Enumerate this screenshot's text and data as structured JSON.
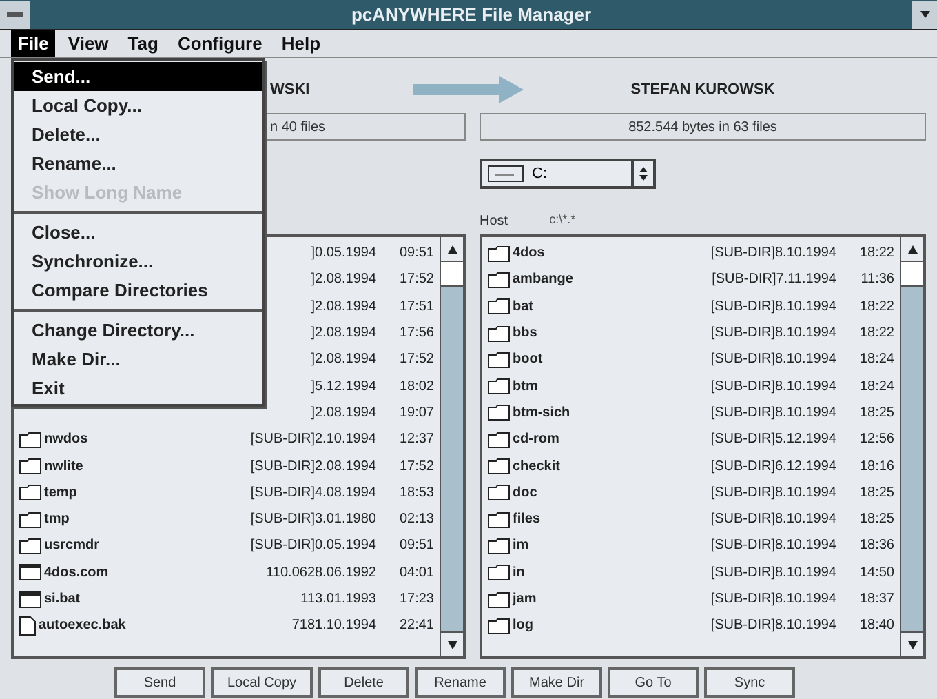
{
  "window": {
    "title": "pcANYWHERE File Manager"
  },
  "menu_bar": [
    {
      "label": "File",
      "selected": true
    },
    {
      "label": "View",
      "selected": false
    },
    {
      "label": "Tag",
      "selected": false
    },
    {
      "label": "Configure",
      "selected": false
    },
    {
      "label": "Help",
      "selected": false
    }
  ],
  "file_menu": [
    {
      "kind": "item",
      "label": "Send...",
      "selected": true,
      "disabled": false
    },
    {
      "kind": "item",
      "label": "Local Copy...",
      "selected": false,
      "disabled": false
    },
    {
      "kind": "item",
      "label": "Delete...",
      "selected": false,
      "disabled": false
    },
    {
      "kind": "item",
      "label": "Rename...",
      "selected": false,
      "disabled": false
    },
    {
      "kind": "item",
      "label": "Show Long Name",
      "selected": false,
      "disabled": true
    },
    {
      "kind": "separator"
    },
    {
      "kind": "item",
      "label": "Close...",
      "selected": false,
      "disabled": false
    },
    {
      "kind": "item",
      "label": "Synchronize...",
      "selected": false,
      "disabled": false
    },
    {
      "kind": "item",
      "label": "Compare Directories",
      "selected": false,
      "disabled": false
    },
    {
      "kind": "separator"
    },
    {
      "kind": "item",
      "label": "Change Directory...",
      "selected": false,
      "disabled": false
    },
    {
      "kind": "item",
      "label": "Make Dir...",
      "selected": false,
      "disabled": false
    },
    {
      "kind": "item",
      "label": "Exit",
      "selected": false,
      "disabled": false
    }
  ],
  "left_panel": {
    "computer": "WSKI",
    "summary": "n 40 files",
    "files": [
      {
        "info": "]0.05.1994",
        "time": "09:51"
      },
      {
        "info": "]2.08.1994",
        "time": "17:52"
      },
      {
        "info": "]2.08.1994",
        "time": "17:51"
      },
      {
        "info": "]2.08.1994",
        "time": "17:56"
      },
      {
        "info": "]2.08.1994",
        "time": "17:52"
      },
      {
        "info": "]5.12.1994",
        "time": "18:02"
      },
      {
        "info": "]2.08.1994",
        "time": "19:07"
      },
      {
        "kind": "folder",
        "name": "nwdos",
        "info": "[SUB-DIR]2.10.1994",
        "time": "12:37"
      },
      {
        "kind": "folder",
        "name": "nwlite",
        "info": "[SUB-DIR]2.08.1994",
        "time": "17:52"
      },
      {
        "kind": "folder",
        "name": "temp",
        "info": "[SUB-DIR]4.08.1994",
        "time": "18:53"
      },
      {
        "kind": "folder",
        "name": "tmp",
        "info": "[SUB-DIR]3.01.1980",
        "time": "02:13"
      },
      {
        "kind": "folder",
        "name": "usrcmdr",
        "info": "[SUB-DIR]0.05.1994",
        "time": "09:51"
      },
      {
        "kind": "program",
        "name": "4dos.com",
        "info": "110.0628.06.1992",
        "time": "04:01"
      },
      {
        "kind": "program",
        "name": "si.bat",
        "info": "113.01.1993",
        "time": "17:23"
      },
      {
        "kind": "document",
        "name": "autoexec.bak",
        "info": "7181.10.1994",
        "time": "22:41"
      }
    ]
  },
  "right_panel": {
    "computer": "STEFAN KUROWSK",
    "summary": "852.544 bytes in 63 files",
    "drive": "C:",
    "path_label": "Host",
    "path": "c:\\*.*",
    "files": [
      {
        "kind": "folder",
        "name": "4dos",
        "info": "[SUB-DIR]8.10.1994",
        "time": "18:22"
      },
      {
        "kind": "folder",
        "name": "ambange",
        "info": "[SUB-DIR]7.11.1994",
        "time": "11:36"
      },
      {
        "kind": "folder",
        "name": "bat",
        "info": "[SUB-DIR]8.10.1994",
        "time": "18:22"
      },
      {
        "kind": "folder",
        "name": "bbs",
        "info": "[SUB-DIR]8.10.1994",
        "time": "18:22"
      },
      {
        "kind": "folder",
        "name": "boot",
        "info": "[SUB-DIR]8.10.1994",
        "time": "18:24"
      },
      {
        "kind": "folder",
        "name": "btm",
        "info": "[SUB-DIR]8.10.1994",
        "time": "18:24"
      },
      {
        "kind": "folder",
        "name": "btm-sich",
        "info": "[SUB-DIR]8.10.1994",
        "time": "18:25"
      },
      {
        "kind": "folder",
        "name": "cd-rom",
        "info": "[SUB-DIR]5.12.1994",
        "time": "12:56"
      },
      {
        "kind": "folder",
        "name": "checkit",
        "info": "[SUB-DIR]6.12.1994",
        "time": "18:16"
      },
      {
        "kind": "folder",
        "name": "doc",
        "info": "[SUB-DIR]8.10.1994",
        "time": "18:25"
      },
      {
        "kind": "folder",
        "name": "files",
        "info": "[SUB-DIR]8.10.1994",
        "time": "18:25"
      },
      {
        "kind": "folder",
        "name": "im",
        "info": "[SUB-DIR]8.10.1994",
        "time": "18:36"
      },
      {
        "kind": "folder",
        "name": "in",
        "info": "[SUB-DIR]8.10.1994",
        "time": "14:50"
      },
      {
        "kind": "folder",
        "name": "jam",
        "info": "[SUB-DIR]8.10.1994",
        "time": "18:37"
      },
      {
        "kind": "folder",
        "name": "log",
        "info": "[SUB-DIR]8.10.1994",
        "time": "18:40"
      }
    ]
  },
  "buttons": [
    "Send",
    "Local Copy",
    "Delete",
    "Rename",
    "Make Dir",
    "Go To",
    "Sync"
  ]
}
